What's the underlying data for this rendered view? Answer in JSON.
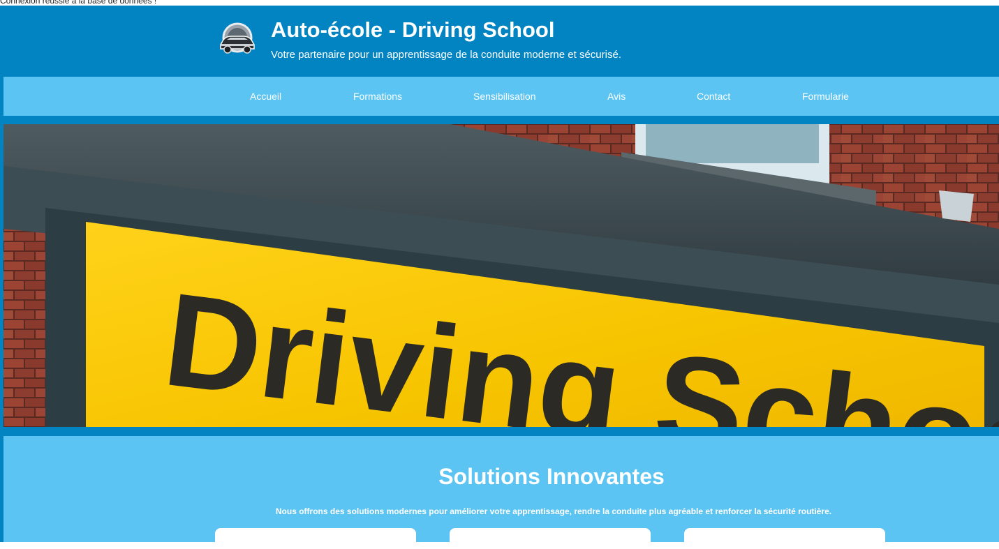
{
  "status": {
    "db_message": "Connexion réussie à la base de données !"
  },
  "header": {
    "logo_icon": "car-logo-icon",
    "title": "Auto-école - Driving School",
    "subtitle": "Votre partenaire pour un apprentissage de la conduite moderne et sécurisé."
  },
  "nav": {
    "items": [
      {
        "label": "Accueil"
      },
      {
        "label": "Formations"
      },
      {
        "label": "Sensibilisation"
      },
      {
        "label": "Avis"
      },
      {
        "label": "Contact"
      },
      {
        "label": "Formularie"
      }
    ]
  },
  "hero": {
    "sign_text": "Driving School"
  },
  "solutions": {
    "title": "Solutions Innovantes",
    "text": "Nous offrons des solutions modernes pour améliorer votre apprentissage, rendre la conduite plus agréable et renforcer la sécurité routière."
  },
  "colors": {
    "header_blue": "#0284c2",
    "nav_light_blue": "#5bc4f2",
    "sign_yellow": "#f7c400",
    "brick": "#8a3a2c"
  }
}
